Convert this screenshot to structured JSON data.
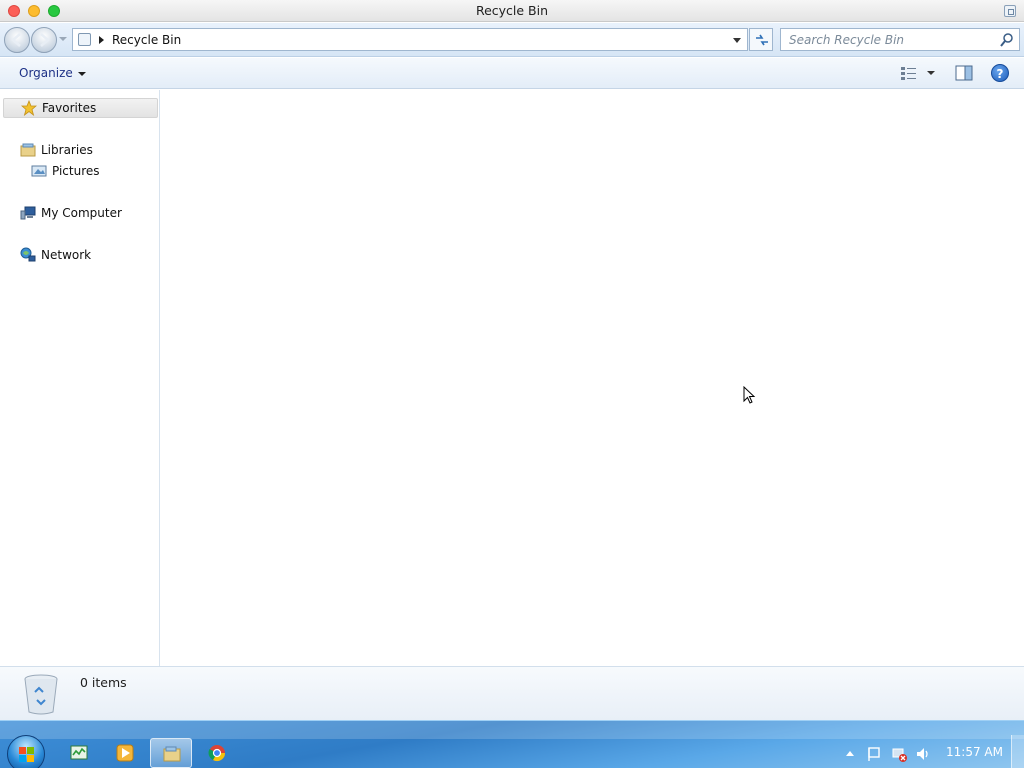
{
  "window": {
    "title": "Recycle Bin",
    "traffic_lights": [
      "close",
      "minimize",
      "maximize"
    ]
  },
  "navbar": {
    "address_path": "Recycle Bin",
    "search_placeholder": "Search Recycle Bin"
  },
  "command_bar": {
    "organize_label": "Organize"
  },
  "nav_pane": {
    "favorites": "Favorites",
    "libraries": "Libraries",
    "pictures": "Pictures",
    "computer": "My Computer",
    "network": "Network"
  },
  "details": {
    "item_count": "0 items"
  },
  "taskbar": {
    "clock": "11:57 AM",
    "pinned": [
      "task-manager-icon",
      "media-player-icon",
      "explorer-icon",
      "chrome-icon"
    ],
    "active_app": "explorer-icon"
  },
  "colors": {
    "accent": "#1e3287",
    "taskbar": "#2f7cc6",
    "close": "#fc5f57",
    "minimize": "#fdbc2e",
    "maximize": "#28c840"
  }
}
